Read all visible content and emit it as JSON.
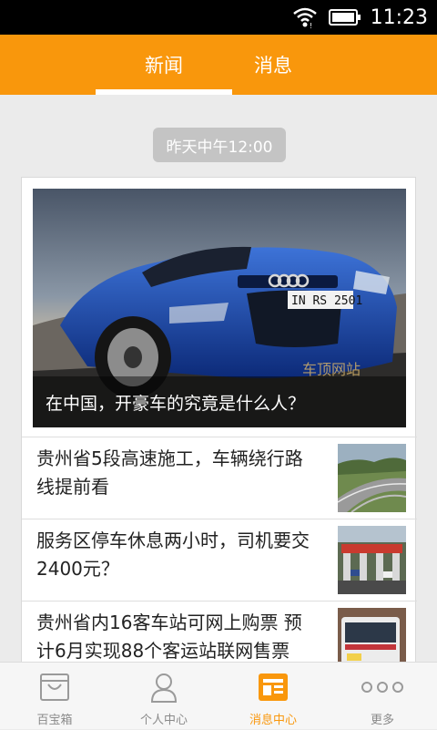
{
  "status_bar": {
    "time": "11:23",
    "icons": [
      "wifi-icon",
      "battery-icon"
    ]
  },
  "top_tabs": [
    {
      "label": "新闻",
      "selected": true
    },
    {
      "label": "消息",
      "selected": false
    }
  ],
  "feed": {
    "timestamp": "昨天中午12:00",
    "hero": {
      "caption": "在中国，开豪车的究竟是什么人？",
      "watermark": "车顶网站",
      "plate": "IN RS 2501"
    },
    "items": [
      {
        "title": "贵州省5段高速施工，车辆绕行路线提前看",
        "thumb": "highway-image"
      },
      {
        "title": "服务区停车休息两小时，司机要交2400元？",
        "thumb": "toll-station-image"
      },
      {
        "title": "贵州省内16客车站可网上购票 预计6月实现88个客运站联网售票",
        "thumb": "bus-image"
      }
    ]
  },
  "bottom_nav": [
    {
      "label": "百宝箱",
      "icon": "bag-icon",
      "active": false
    },
    {
      "label": "个人中心",
      "icon": "person-icon",
      "active": false
    },
    {
      "label": "消息中心",
      "icon": "news-icon",
      "active": true
    },
    {
      "label": "更多",
      "icon": "more-dots-icon",
      "active": false
    }
  ],
  "colors": {
    "accent": "#f9970c",
    "statusbar": "#000000",
    "background": "#ebebeb",
    "inactive": "#8a8a8a"
  }
}
